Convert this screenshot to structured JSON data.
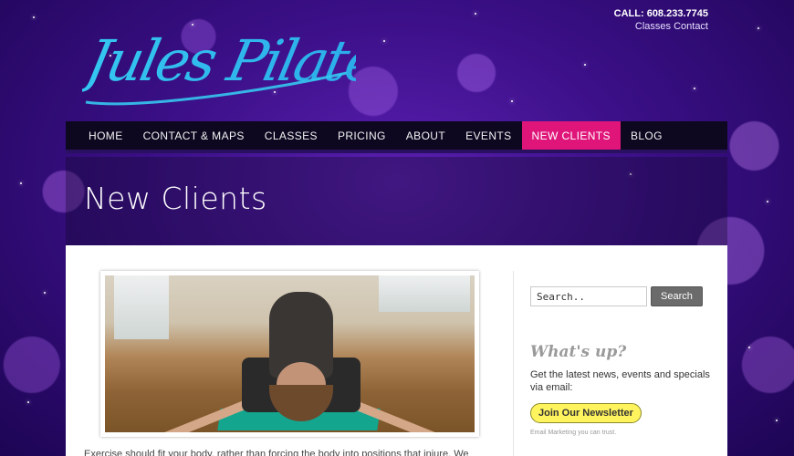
{
  "header": {
    "logo_text": "Jules Pilates",
    "call": "CALL: 608.233.7745",
    "links": [
      "Classes",
      "Contact"
    ]
  },
  "nav": {
    "items": [
      {
        "label": "HOME",
        "active": false
      },
      {
        "label": "CONTACT & MAPS",
        "active": false
      },
      {
        "label": "CLASSES",
        "active": false
      },
      {
        "label": "PRICING",
        "active": false
      },
      {
        "label": "ABOUT",
        "active": false
      },
      {
        "label": "EVENTS",
        "active": false
      },
      {
        "label": "NEW CLIENTS",
        "active": true
      },
      {
        "label": "BLOG",
        "active": false
      }
    ]
  },
  "page": {
    "title": "New Clients",
    "body_excerpt": "Exercise should fit your body, rather than forcing the body into positions that injure.  We"
  },
  "sidebar": {
    "search_placeholder": "Search..",
    "search_button": "Search",
    "whats_up_title": "What's up?",
    "whats_up_text": "Get the latest news, events and specials via email:",
    "newsletter_button": "Join Our Newsletter",
    "email_marketing": "Email Marketing you can trust."
  },
  "colors": {
    "accent_pink": "#e0157a",
    "nav_bg": "#0d0820",
    "logo_cyan": "#35c8f0",
    "newsletter_yellow": "#fff45e"
  }
}
